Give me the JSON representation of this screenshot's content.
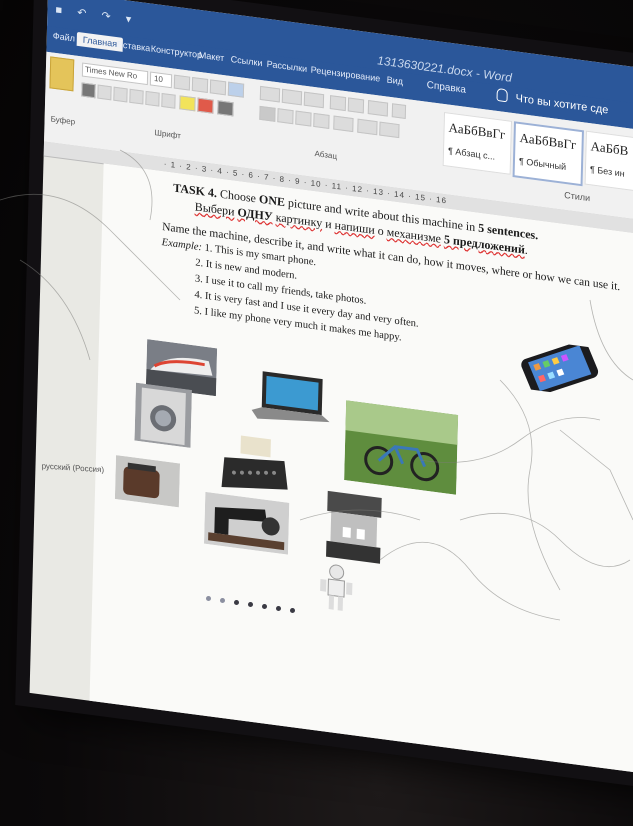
{
  "window": {
    "doc_title": "1313630221.docx - Word",
    "quick_access": "■ ↶ ↷ ▾"
  },
  "tabs": [
    "Файл",
    "Главная",
    "Вставка",
    "Конструктор",
    "Макет",
    "Ссылки",
    "Рассылки",
    "Рецензирование",
    "Вид",
    "Справка"
  ],
  "tell_me": "Что вы хотите сде",
  "ribbon": {
    "font_name": "Times New Ro",
    "font_size": "10",
    "clipboard_label": "Буфер",
    "font_group_label": "Шрифт",
    "paragraph_group_label": "Абзац",
    "styles_group_label": "Стили",
    "styles": [
      {
        "sample": "АаБбВвГг",
        "name": "¶ Абзац с..."
      },
      {
        "sample": "АаБбВвГг",
        "name": "¶ Обычный"
      },
      {
        "sample": "АаБбВ",
        "name": "¶ Без ин"
      }
    ]
  },
  "ruler": "· 1 · 2 · 3 · 4 · 5 · 6 · 7 · 8 · 9 · 10 · 11 · 12 · 13 · 14 · 15 · 16",
  "document": {
    "task_prefix": "TASK 4.",
    "task_a": " Choose ",
    "task_one": "ONE",
    "task_b": " picture and write about this machine in ",
    "task_bold": "5 sentences.",
    "ru_a": "Выбери",
    "ru_b": "ОДНУ",
    "ru_c": "картинку",
    "ru_d": " и ",
    "ru_e": "напиши",
    "ru_f": " о ",
    "ru_g": "механизме",
    "ru_h": "5 предложений",
    "ru_end": ".",
    "instruction": "Name the machine, describe it, and write what it can do, how it moves, where or how we can use it.",
    "example_label": "Example:",
    "examples": [
      "1. This is my smart phone.",
      "2. It is new and modern.",
      "3. I use it to call my friends, take photos.",
      "4. It is very fast and I use it every day and very often.",
      "5. I like my phone very much it makes me happy."
    ]
  },
  "status": {
    "lang": "русский (Россия)"
  },
  "colors": {
    "word_blue": "#2b579a",
    "page": "#fafaf8",
    "bezel": "#121013"
  },
  "images": [
    "smartphone",
    "train",
    "laptop",
    "bicycle",
    "washing-machine",
    "typewriter",
    "coffee-machine",
    "sewing-machine",
    "robot",
    "toaster"
  ]
}
